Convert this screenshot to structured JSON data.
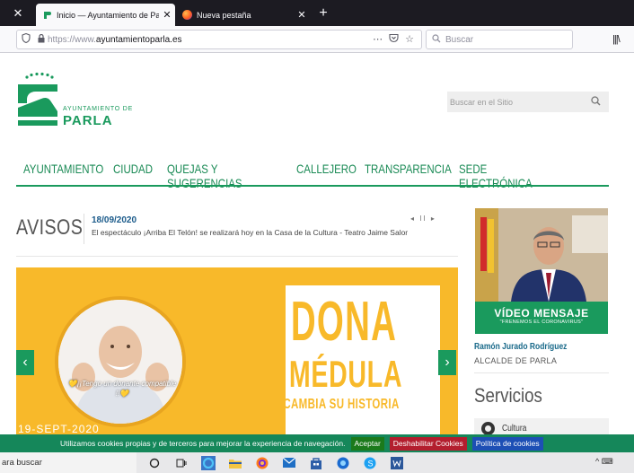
{
  "browser": {
    "tabs": [
      {
        "title": "Inicio — Ayuntamiento de Parla",
        "close": "✕",
        "active": true
      },
      {
        "title": "Nueva pestaña",
        "close": "✕",
        "active": false
      }
    ],
    "close_left": "✕",
    "new_tab": "+",
    "url_scheme": "https://www.",
    "url_domain": "ayuntamientoparla.es",
    "search_placeholder": "Buscar",
    "icons": [
      "shield-icon",
      "lock-icon",
      "more-icon",
      "pocket-icon",
      "bookmark-star-icon",
      "search-icon",
      "library-icon"
    ]
  },
  "site": {
    "logo": {
      "line1": "AYUNTAMIENTO DE",
      "line2": "PARLA"
    },
    "search_placeholder": "Buscar en el Sitio",
    "nav": [
      "AYUNTAMIENTO",
      "CIUDAD",
      "QUEJAS Y SUGERENCIAS",
      "CALLEJERO",
      "TRANSPARENCIA",
      "SEDE ELECTRÓNICA"
    ],
    "avisos": {
      "title": "AVISOS",
      "date": "18/09/2020",
      "text": "El espectáculo ¡Arriba El Telón! se realizará hoy en la Casa de la Cultura - Teatro Jaime Salom",
      "controls": "◂ II ▸"
    },
    "banner": {
      "dona": "DONA",
      "medula": "MÉDULA",
      "cambia": "CAMBIA SU HISTORIA",
      "quote": "💛¡¡Tengo un donante compatible !!💛",
      "date": "19-SEPT-2020",
      "prev": "‹",
      "next": "›"
    },
    "video": {
      "title": "VÍDEO MENSAJE",
      "subtitle": "\"FRENEMOS EL CORONAVIRUS\""
    },
    "mayor": {
      "name": "Ramón Jurado Rodríguez",
      "role": "ALCALDE DE PARLA"
    },
    "servicios": {
      "title": "Servicios",
      "items": [
        "Cultura"
      ]
    }
  },
  "cookies": {
    "text": "Utilizamos cookies propias y de terceros para mejorar la experiencia de navegación.",
    "accept": "Aceptar",
    "disable": "Deshabilitar Cookies",
    "policy": "Política de cookies"
  },
  "taskbar": {
    "search_text": "ara buscar",
    "tray": "^ ⌨"
  },
  "colors": {
    "brand_green": "#1a9a5d",
    "banner_yellow": "#f8b92a",
    "cookie_green": "#15875a",
    "accept_green": "#1b7a1b",
    "disable_red": "#b31e2e",
    "policy_blue": "#1d4fb5"
  }
}
